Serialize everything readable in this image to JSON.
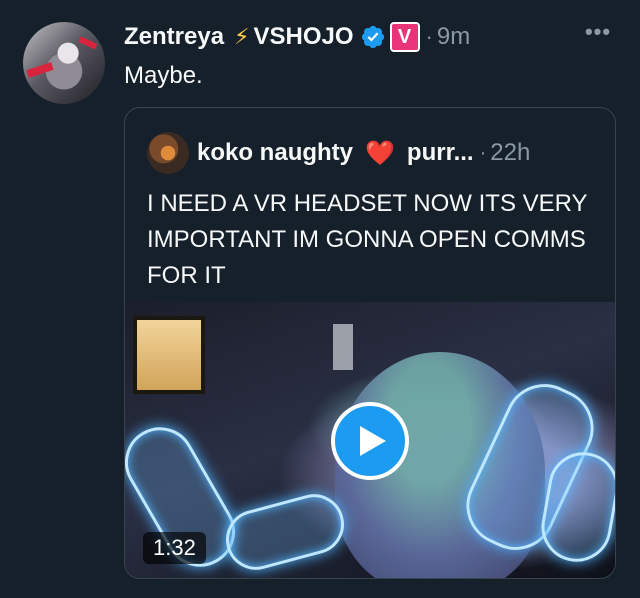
{
  "tweet": {
    "author_name": "Zentreya",
    "author_emoji": "⚡",
    "org_label": "VSHOJO",
    "vshojo_badge": "V",
    "separator": "·",
    "timestamp": "9m",
    "more_icon": "more-options-icon",
    "more_glyph": "•••",
    "text": "Maybe."
  },
  "quoted": {
    "author_name": "koko naughty",
    "heart": "❤️",
    "handle": "purr...",
    "separator": "·",
    "timestamp": "22h",
    "text": "I NEED A VR HEADSET NOW ITS VERY IMPORTANT IM GONNA OPEN COMMS FOR IT",
    "video": {
      "duration": "1:32",
      "play_icon": "play-icon"
    }
  },
  "colors": {
    "background": "#15202b",
    "accent": "#1d9bf0",
    "muted_text": "#8b98a5",
    "border": "#38444d",
    "vshojo_pink": "#e9347a"
  }
}
